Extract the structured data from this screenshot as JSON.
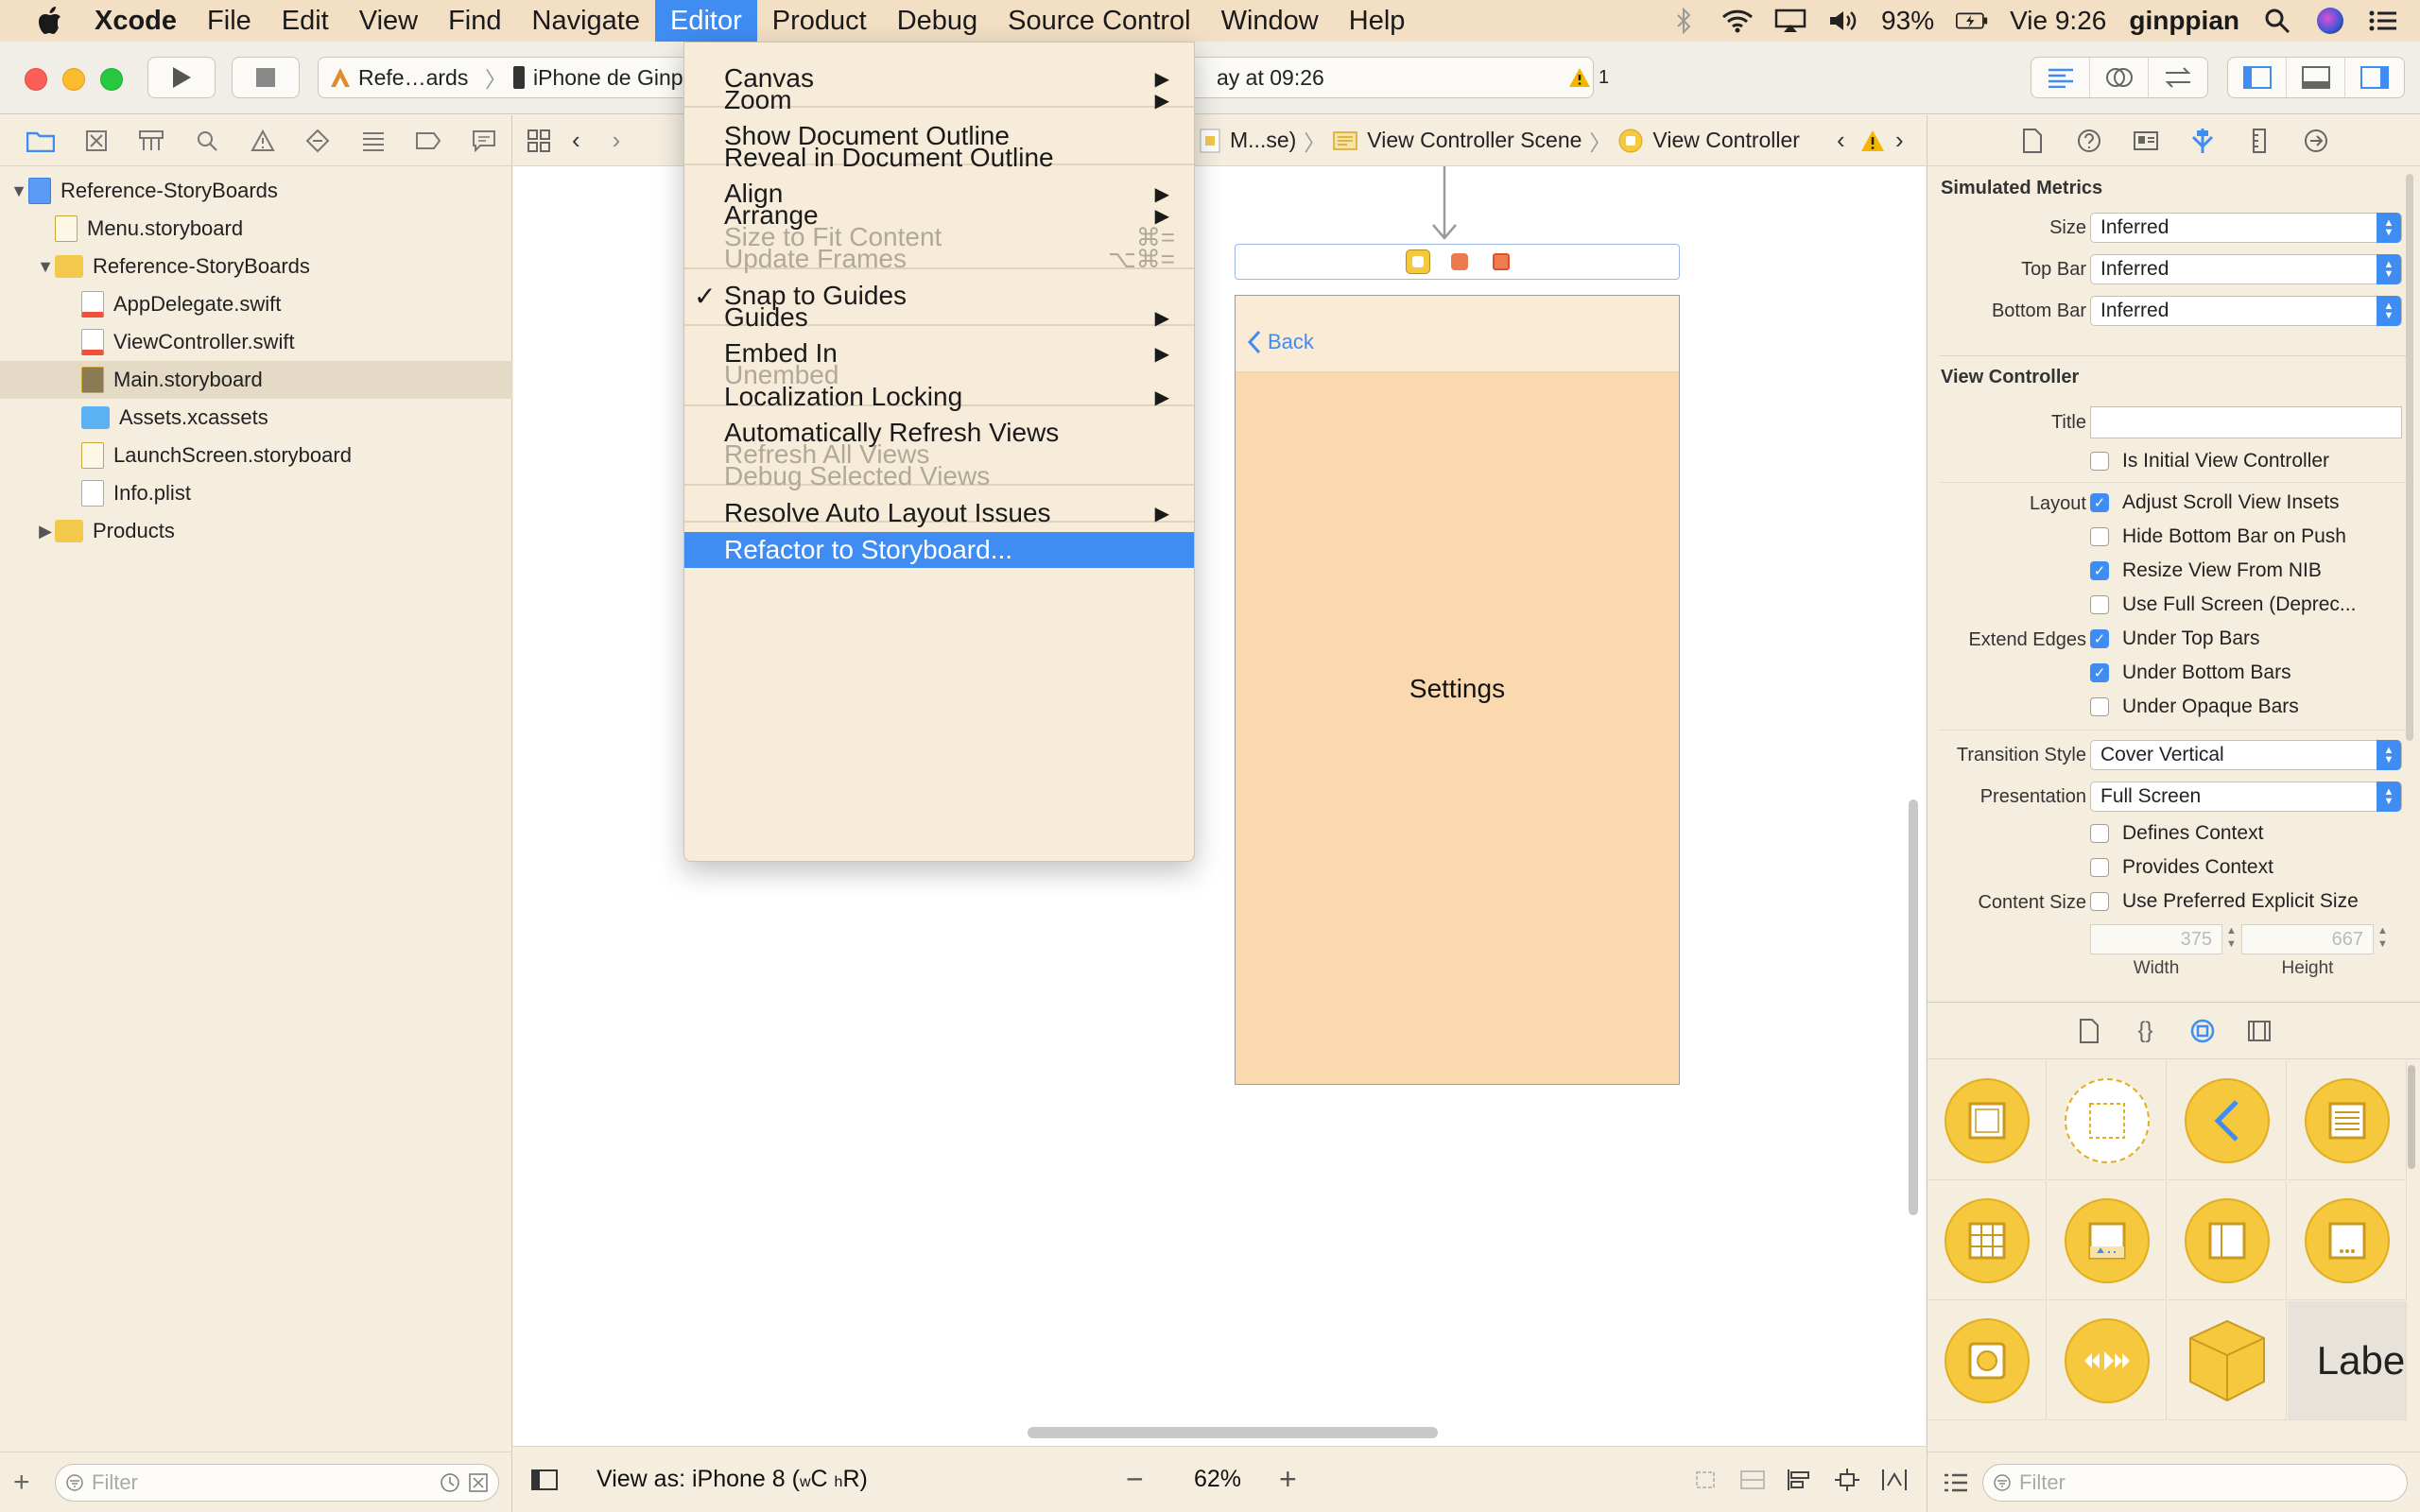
{
  "menubar": {
    "app": "Xcode",
    "items": [
      "File",
      "Edit",
      "View",
      "Find",
      "Navigate",
      "Editor",
      "Product",
      "Debug",
      "Source Control",
      "Window",
      "Help"
    ],
    "active": "Editor",
    "battery": "93%",
    "clock": "Vie 9:26",
    "user": "ginppian"
  },
  "toolbar": {
    "scheme": "Refe…ards",
    "device": "iPhone de Ginp",
    "status": "ay at 09:26",
    "warning_count": "1"
  },
  "navigator": {
    "tree": [
      {
        "label": "Reference-StoryBoards",
        "level": 0,
        "disclosure": "open",
        "icon": "project-icon"
      },
      {
        "label": "Menu.storyboard",
        "level": 1,
        "icon": "storyboard-file-icon"
      },
      {
        "label": "Reference-StoryBoards",
        "level": 1,
        "disclosure": "open",
        "icon": "folder-icon"
      },
      {
        "label": "AppDelegate.swift",
        "level": 2,
        "icon": "swift-file-icon"
      },
      {
        "label": "ViewController.swift",
        "level": 2,
        "icon": "swift-file-icon"
      },
      {
        "label": "Main.storyboard",
        "level": 2,
        "icon": "storyboard-file-icon",
        "selected": true
      },
      {
        "label": "Assets.xcassets",
        "level": 2,
        "icon": "asset-catalog-icon"
      },
      {
        "label": "LaunchScreen.storyboard",
        "level": 2,
        "icon": "storyboard-file-icon"
      },
      {
        "label": "Info.plist",
        "level": 2,
        "icon": "plist-file-icon"
      },
      {
        "label": "Products",
        "level": 1,
        "disclosure": "closed",
        "icon": "folder-icon"
      }
    ],
    "filter_placeholder": "Filter"
  },
  "jumpbar": {
    "crumb1": "M...se)",
    "crumb2": "View Controller Scene",
    "crumb3": "View Controller"
  },
  "scene": {
    "back_label": "Back",
    "content_label": "Settings"
  },
  "editor_footer": {
    "view_as_prefix": "View as: iPhone 8 (",
    "size_class_w": "w",
    "size_class_w_val": "C",
    "size_class_h": "h",
    "size_class_h_val": "R",
    "view_as_suffix": ")",
    "zoom": "62%"
  },
  "editor_menu": {
    "items": [
      {
        "label": "Canvas",
        "submenu": true
      },
      {
        "label": "Zoom",
        "submenu": true
      },
      {
        "label": "Show Document Outline"
      },
      {
        "label": "Reveal in Document Outline"
      },
      {
        "label": "Align",
        "submenu": true
      },
      {
        "label": "Arrange",
        "submenu": true
      },
      {
        "label": "Size to Fit Content",
        "disabled": true,
        "shortcut": "⌘="
      },
      {
        "label": "Update Frames",
        "disabled": true,
        "shortcut": "⌥⌘="
      },
      {
        "label": "Snap to Guides",
        "checked": true
      },
      {
        "label": "Guides",
        "submenu": true
      },
      {
        "label": "Embed In",
        "submenu": true
      },
      {
        "label": "Unembed",
        "disabled": true
      },
      {
        "label": "Localization Locking",
        "submenu": true
      },
      {
        "label": "Automatically Refresh Views"
      },
      {
        "label": "Refresh All Views",
        "disabled": true
      },
      {
        "label": "Debug Selected Views",
        "disabled": true
      },
      {
        "label": "Resolve Auto Layout Issues",
        "submenu": true
      },
      {
        "label": "Refactor to Storyboard...",
        "highlighted": true
      }
    ]
  },
  "inspector": {
    "simulated_metrics_title": "Simulated Metrics",
    "size_label": "Size",
    "size_value": "Inferred",
    "topbar_label": "Top Bar",
    "topbar_value": "Inferred",
    "bottombar_label": "Bottom Bar",
    "bottombar_value": "Inferred",
    "vc_title": "View Controller",
    "title_label": "Title",
    "initial_vc": "Is Initial View Controller",
    "layout_label": "Layout",
    "adjust_scroll": "Adjust Scroll View Insets",
    "hide_bottom": "Hide Bottom Bar on Push",
    "resize_nib": "Resize View From NIB",
    "full_screen": "Use Full Screen (Deprec...",
    "extend_label": "Extend Edges",
    "under_top": "Under Top Bars",
    "under_bottom": "Under Bottom Bars",
    "under_opaque": "Under Opaque Bars",
    "transition_label": "Transition Style",
    "transition_value": "Cover Vertical",
    "presentation_label": "Presentation",
    "presentation_value": "Full Screen",
    "defines_context": "Defines Context",
    "provides_context": "Provides Context",
    "content_size_label": "Content Size",
    "preferred_size": "Use Preferred Explicit Size",
    "width_value": "375",
    "height_value": "667",
    "width_label": "Width",
    "height_label": "Height"
  },
  "library": {
    "label_item": "Labe",
    "filter_placeholder": "Filter"
  },
  "colors": {
    "accent": "#3f8cf3",
    "scene_bg": "#fbd9ae",
    "library_yellow": "#f5c83d"
  }
}
